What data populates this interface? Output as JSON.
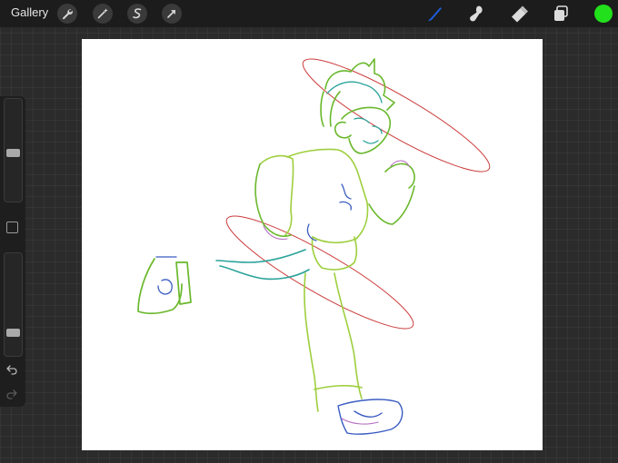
{
  "topbar": {
    "gallery_label": "Gallery",
    "left_tools": [
      "wrench-icon",
      "magic-wand-icon",
      "selection-icon",
      "transform-arrow-icon"
    ],
    "right_tools": [
      "brush-icon",
      "smudge-icon",
      "eraser-icon",
      "layers-icon"
    ],
    "active_tool": "brush",
    "brush_color": "#1e5bd6",
    "current_color": "#22e01b"
  },
  "sidebar": {
    "brush_size_level": 0.47,
    "opacity_level": 0.2,
    "items": [
      "brush-size-slider",
      "modify-button",
      "opacity-slider",
      "undo-icon",
      "redo-icon"
    ]
  },
  "canvas": {
    "background": "#ffffff",
    "sketch_subject": "running-character",
    "stroke_colors": [
      "#6ab82c",
      "#9dcf3d",
      "#2aa39a",
      "#3a5cc2",
      "#b66cc2"
    ],
    "guide_ellipse_color": "#cc3b3b"
  }
}
